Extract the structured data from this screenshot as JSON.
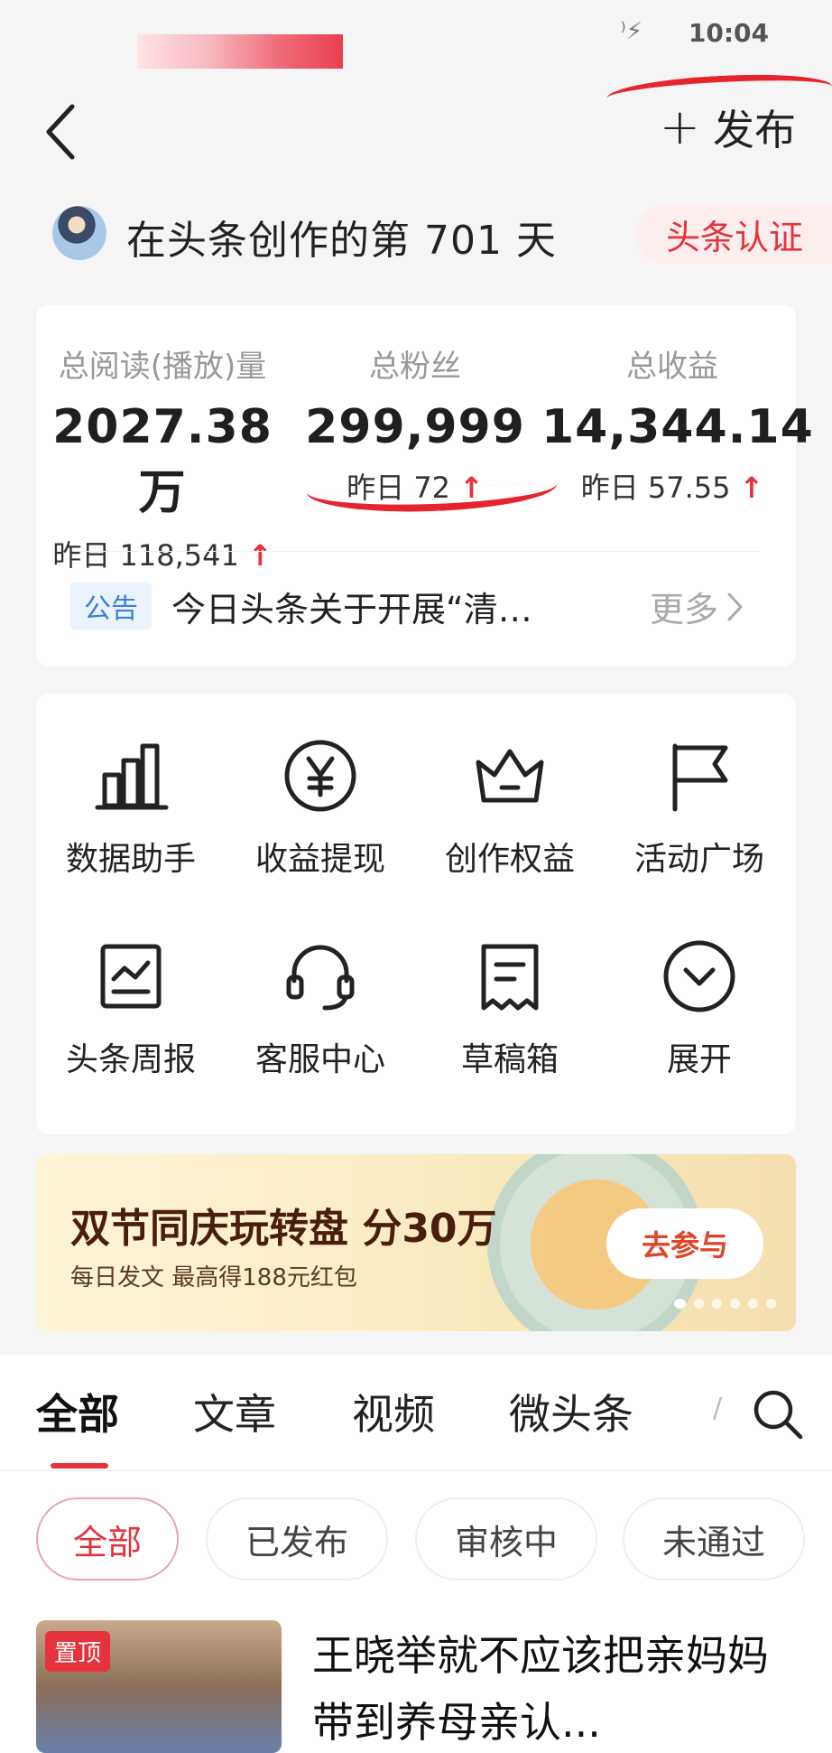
{
  "status_bar": {
    "time": "10:04",
    "icons": "⁾⚡"
  },
  "header": {
    "back_icon": "chevron-left-icon",
    "publish_label": "发布",
    "publish_plus": "+"
  },
  "greeting": {
    "text": "在头条创作的第 701 天",
    "badge": "头条认证"
  },
  "stats": [
    {
      "label": "总阅读(播放)量",
      "value": "2027.38万",
      "delta": "昨日 118,541",
      "arrow": "↑"
    },
    {
      "label": "总粉丝",
      "value": "299,999",
      "delta": "昨日 72",
      "arrow": "↑"
    },
    {
      "label": "总收益",
      "value": "14,344.14",
      "delta": "昨日 57.55",
      "arrow": "↑"
    }
  ],
  "notice": {
    "tag": "公告",
    "text": "今日头条关于开展“清朗·E...",
    "more": "更多"
  },
  "tools": [
    {
      "label": "数据助手",
      "icon": "bar-chart-icon"
    },
    {
      "label": "收益提现",
      "icon": "yuan-coin-icon"
    },
    {
      "label": "创作权益",
      "icon": "crown-icon"
    },
    {
      "label": "活动广场",
      "icon": "flag-icon"
    },
    {
      "label": "头条周报",
      "icon": "report-chart-icon"
    },
    {
      "label": "客服中心",
      "icon": "headset-icon"
    },
    {
      "label": "草稿箱",
      "icon": "draft-document-icon"
    },
    {
      "label": "展开",
      "icon": "expand-circle-icon"
    }
  ],
  "banner": {
    "title": "双节同庆玩转盘 分30万",
    "subtitle": "每日发文 最高得188元红包",
    "button": "去参与"
  },
  "content_tabs": [
    "全部",
    "文章",
    "视频",
    "微头条"
  ],
  "tab_more": "/",
  "filter_chips": [
    "全部",
    "已发布",
    "审核中",
    "未通过"
  ],
  "article": {
    "pin": "置顶",
    "title": "王晓举就不应该把亲妈妈带到养母亲认..."
  },
  "colors": {
    "accent": "#e5323d",
    "notice_blue": "#3c7fd6",
    "background": "#f5f5f5"
  }
}
